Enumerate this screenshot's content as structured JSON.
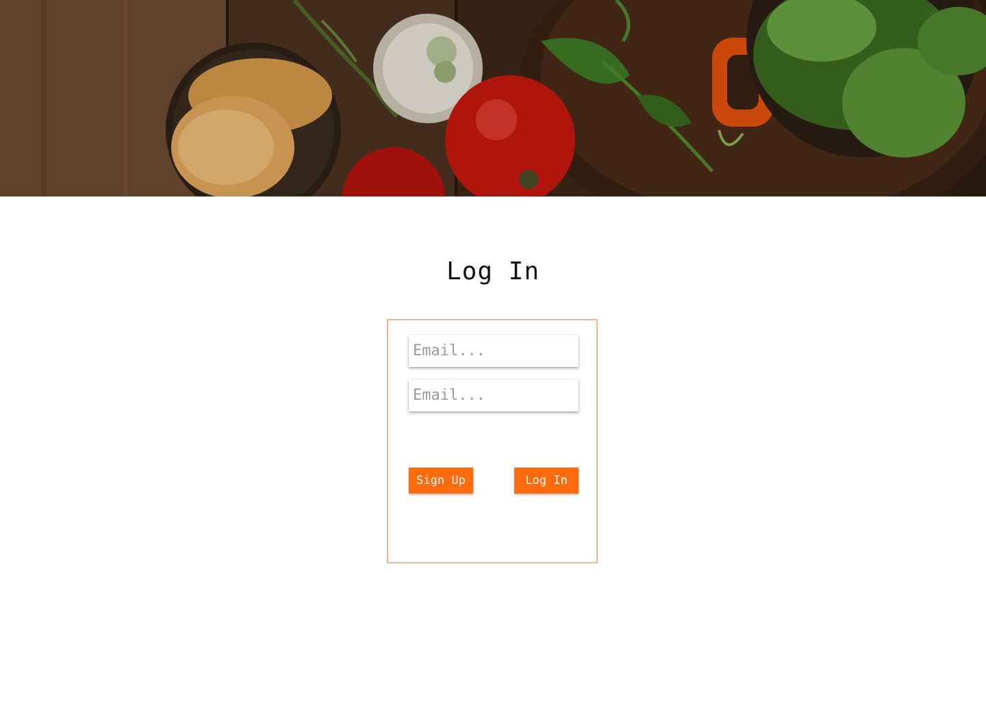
{
  "hero": {
    "image_description_icon": "food-photo-banner"
  },
  "page": {
    "title": "Log In"
  },
  "form": {
    "field_1": {
      "value": "",
      "placeholder": "Email..."
    },
    "field_2": {
      "value": "",
      "placeholder": "Email..."
    },
    "signup_label": "Sign Up",
    "login_label": "Log In"
  },
  "colors": {
    "accent": "#ff6a0d",
    "card_border": "#f7b48c",
    "title_text": "#111111"
  }
}
